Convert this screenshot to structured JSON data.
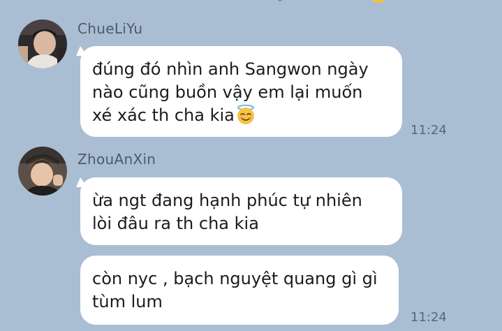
{
  "chat": {
    "messages": [
      {
        "sender": "ChueLiYu",
        "bubbles": [
          {
            "text_before_emoji": "đúng đó nhìn anh Sangwon ngày\nnào cũng buồn vậy em lại muốn\nxé xác th cha kia",
            "emoji": "smiling-face-with-halo",
            "time": "11:24"
          }
        ]
      },
      {
        "sender": "ZhouAnXin",
        "bubbles": [
          {
            "text": "ừa ngt đang hạnh phúc tự nhiên\nlòi đâu ra th cha kia"
          },
          {
            "text": "còn nyc , bạch nguyệt quang gì gì\ntùm lum",
            "time": "11:24"
          }
        ]
      }
    ]
  },
  "colors": {
    "background": "#a9bed3",
    "bubble": "#ffffff",
    "sender_name": "#505a66",
    "timestamp": "#5b6773"
  }
}
